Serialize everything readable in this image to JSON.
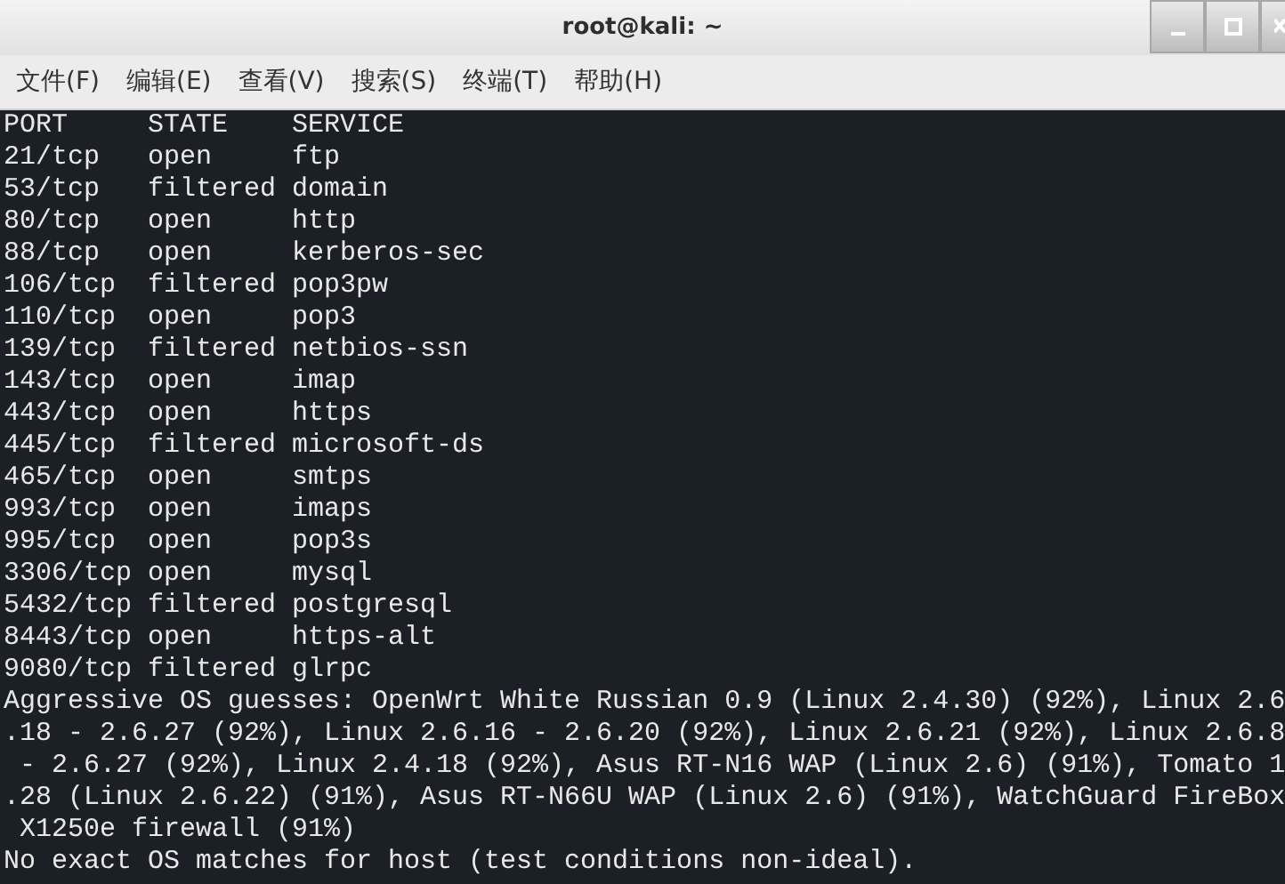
{
  "window": {
    "title": "root@kali: ~"
  },
  "menu": [
    "文件(F)",
    "编辑(E)",
    "查看(V)",
    "搜索(S)",
    "终端(T)",
    "帮助(H)"
  ],
  "table": {
    "columns": [
      "PORT",
      "STATE",
      "SERVICE"
    ],
    "rows": [
      [
        "21/tcp",
        "open",
        "ftp"
      ],
      [
        "53/tcp",
        "filtered",
        "domain"
      ],
      [
        "80/tcp",
        "open",
        "http"
      ],
      [
        "88/tcp",
        "open",
        "kerberos-sec"
      ],
      [
        "106/tcp",
        "filtered",
        "pop3pw"
      ],
      [
        "110/tcp",
        "open",
        "pop3"
      ],
      [
        "139/tcp",
        "filtered",
        "netbios-ssn"
      ],
      [
        "143/tcp",
        "open",
        "imap"
      ],
      [
        "443/tcp",
        "open",
        "https"
      ],
      [
        "445/tcp",
        "filtered",
        "microsoft-ds"
      ],
      [
        "465/tcp",
        "open",
        "smtps"
      ],
      [
        "993/tcp",
        "open",
        "imaps"
      ],
      [
        "995/tcp",
        "open",
        "pop3s"
      ],
      [
        "3306/tcp",
        "open",
        "mysql"
      ],
      [
        "5432/tcp",
        "filtered",
        "postgresql"
      ],
      [
        "8443/tcp",
        "open",
        "https-alt"
      ],
      [
        "9080/tcp",
        "filtered",
        "glrpc"
      ]
    ]
  },
  "output_lines": [
    "Aggressive OS guesses: OpenWrt White Russian 0.9 (Linux 2.4.30) (92%), Linux 2.6",
    ".18 - 2.6.27 (92%), Linux 2.6.16 - 2.6.20 (92%), Linux 2.6.21 (92%), Linux 2.6.8",
    " - 2.6.27 (92%), Linux 2.4.18 (92%), Asus RT-N16 WAP (Linux 2.6) (91%), Tomato 1",
    ".28 (Linux 2.6.22) (91%), Asus RT-N66U WAP (Linux 2.6) (91%), WatchGuard FireBox",
    " X1250e firewall (91%)",
    "No exact OS matches for host (test conditions non-ideal)."
  ]
}
